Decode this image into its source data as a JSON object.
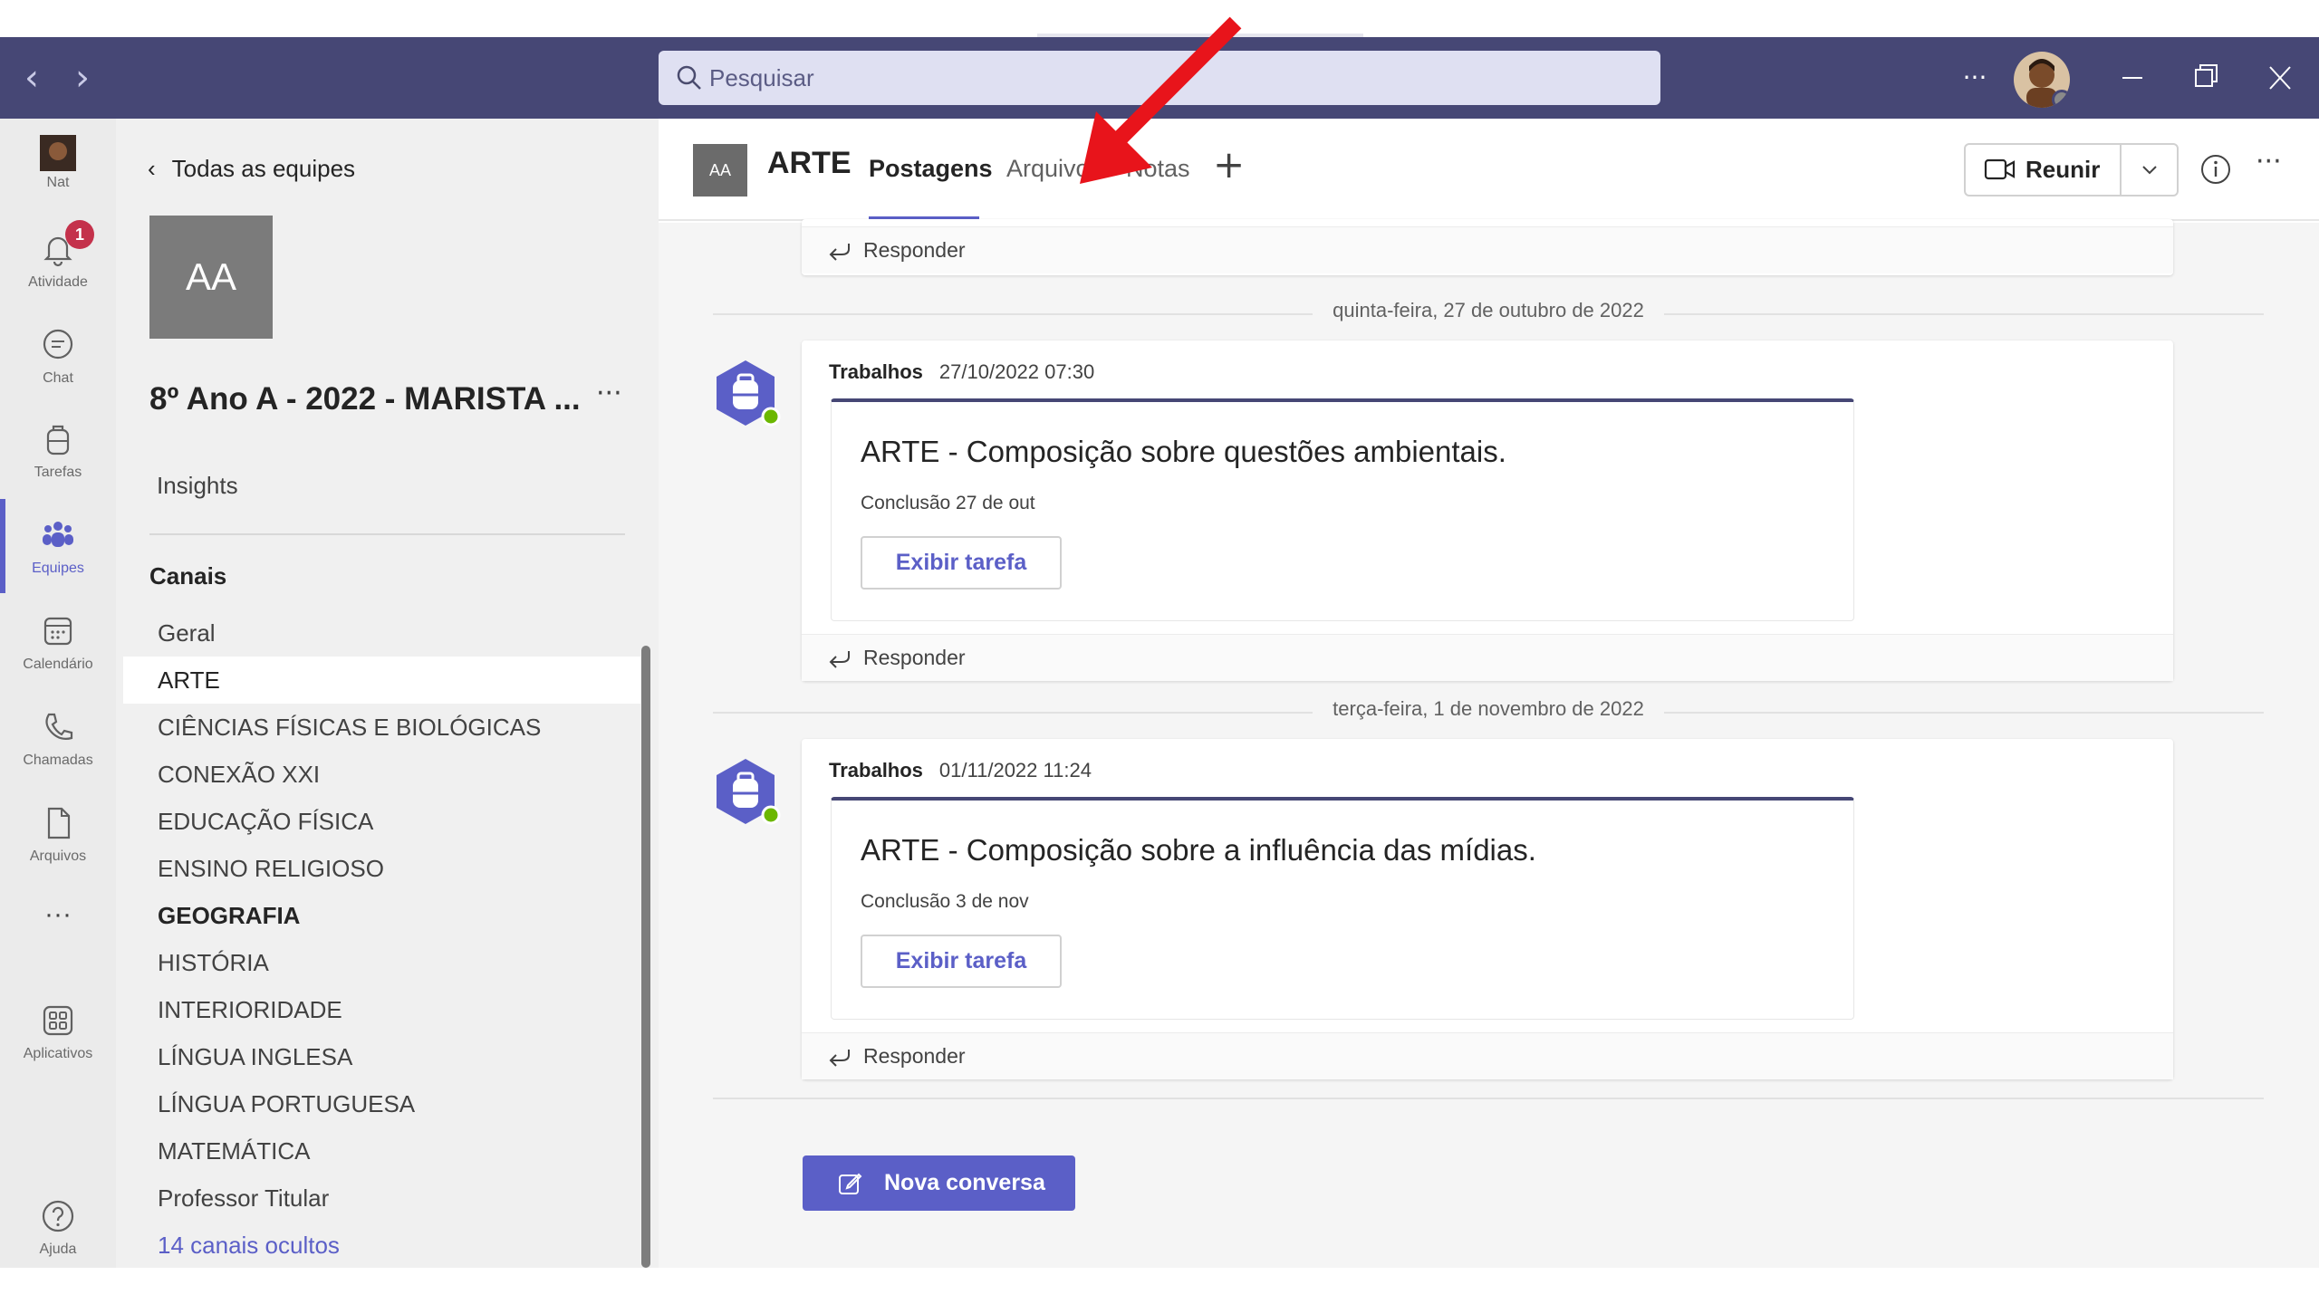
{
  "titlebar": {
    "search_placeholder": "Pesquisar",
    "more": "···"
  },
  "rail": {
    "items": [
      {
        "label": "Nat"
      },
      {
        "label": "Atividade",
        "badge": "1"
      },
      {
        "label": "Chat"
      },
      {
        "label": "Tarefas"
      },
      {
        "label": "Equipes"
      },
      {
        "label": "Calendário"
      },
      {
        "label": "Chamadas"
      },
      {
        "label": "Arquivos"
      },
      {
        "label": "···"
      },
      {
        "label": "Aplicativos"
      },
      {
        "label": "Ajuda"
      }
    ]
  },
  "team": {
    "back_label": "Todas as equipes",
    "tile": "AA",
    "name": "8º Ano A - 2022 - MARISTA ...",
    "more": "···",
    "insights": "Insights",
    "channels_heading": "Canais",
    "channels": [
      "Geral",
      "ARTE",
      "CIÊNCIAS FÍSICAS E BIOLÓGICAS",
      "CONEXÃO XXI",
      "EDUCAÇÃO FÍSICA",
      "ENSINO RELIGIOSO",
      "GEOGRAFIA",
      "HISTÓRIA",
      "INTERIORIDADE",
      "LÍNGUA INGLESA",
      "LÍNGUA PORTUGUESA",
      "MATEMÁTICA",
      "Professor Titular"
    ],
    "hidden_channels": "14 canais ocultos"
  },
  "header": {
    "tile": "AA",
    "channel_name": "ARTE",
    "tabs": [
      "Postagens",
      "Arquivos",
      "Notas"
    ],
    "add_tab": "+",
    "meet_label": "Reunir",
    "more": "···"
  },
  "feed": {
    "reply_label": "Responder",
    "posts": [
      {
        "date": "quinta-feira, 27 de outubro de 2022",
        "author": "Trabalhos",
        "timestamp": "27/10/2022 07:30",
        "title": "ARTE - Composição sobre questões ambientais.",
        "due": "Conclusão 27 de out",
        "button": "Exibir tarefa"
      },
      {
        "date": "terça-feira, 1 de novembro de 2022",
        "author": "Trabalhos",
        "timestamp": "01/11/2022 11:24",
        "title": "ARTE - Composição sobre a influência das mídias.",
        "due": "Conclusão 3 de nov",
        "button": "Exibir tarefa"
      }
    ],
    "new_conversation": "Nova conversa"
  },
  "colors": {
    "titlebar": "#464775",
    "accent": "#5b5fc7",
    "annotation_arrow": "#e8141b"
  }
}
